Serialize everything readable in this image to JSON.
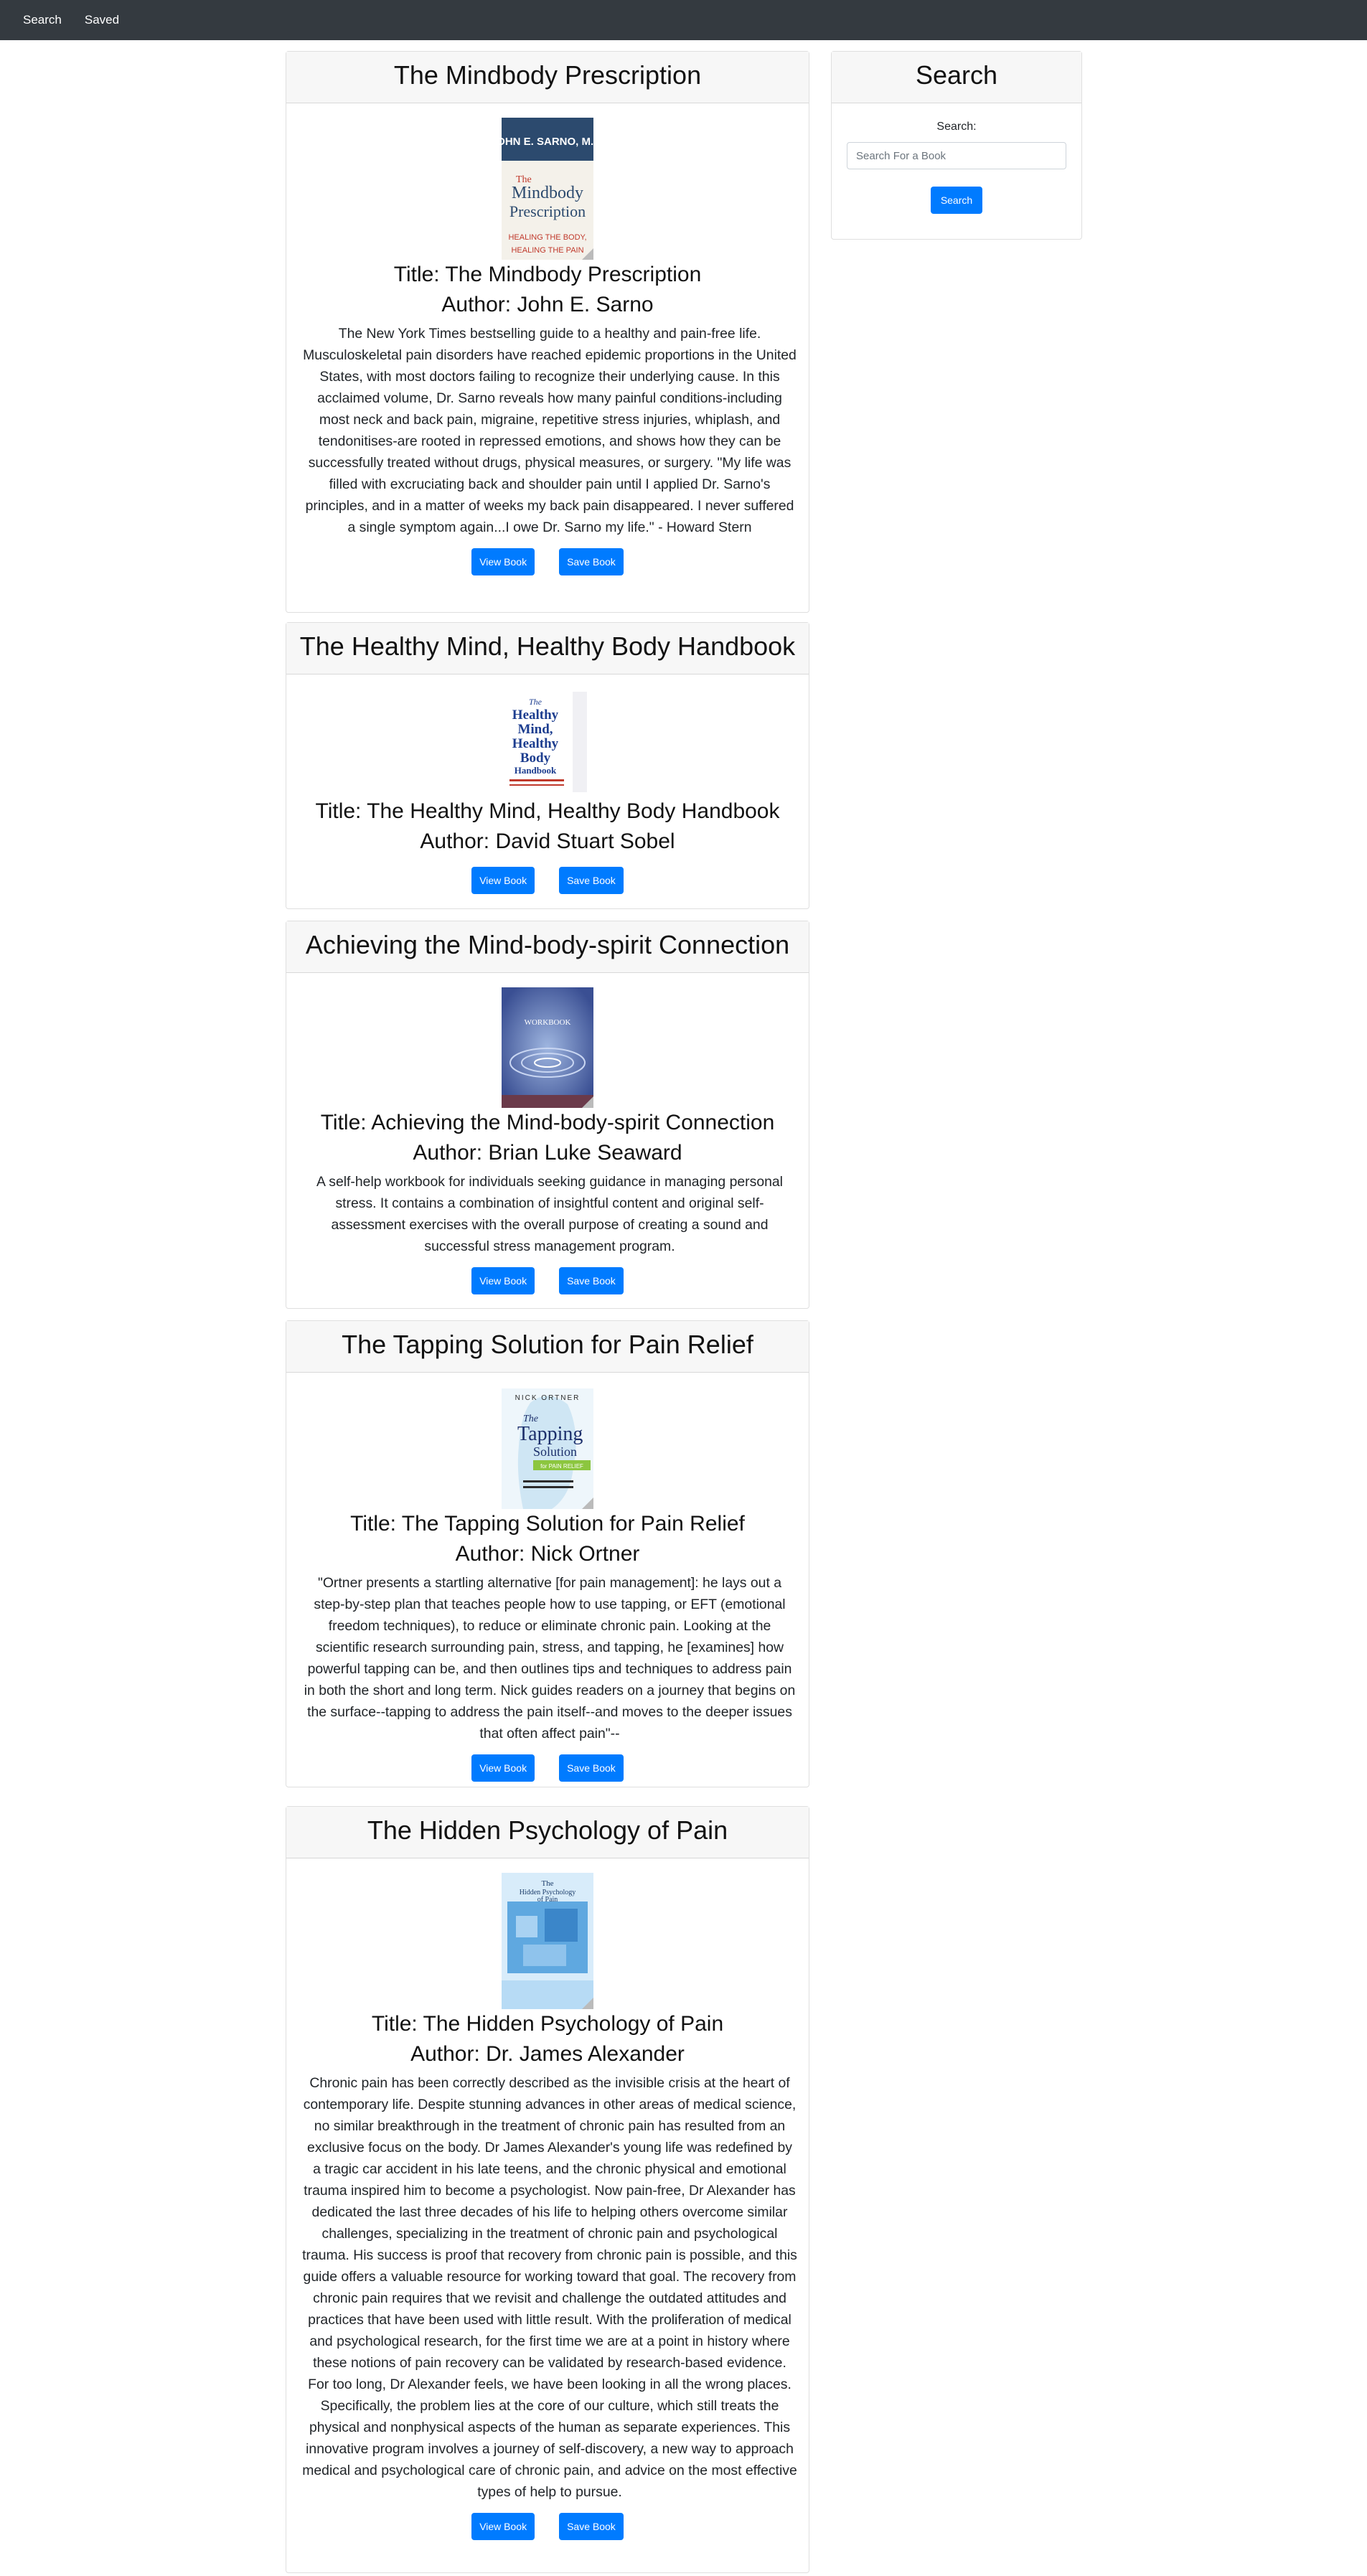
{
  "nav": {
    "links": [
      {
        "label": "Search"
      },
      {
        "label": "Saved"
      }
    ]
  },
  "search_panel": {
    "header": "Search",
    "label": "Search:",
    "placeholder": "Search For a Book",
    "button": "Search"
  },
  "colors": {
    "navbar": "#343a40",
    "primary": "#007bff",
    "card_header": "#f7f7f7"
  },
  "books": [
    {
      "heading": "The Mindbody Prescription",
      "title": "Title: The Mindbody Prescription",
      "author": "Author: John E. Sarno",
      "description": "The New York Times bestselling guide to a healthy and pain-free life. Musculoskeletal pain disorders have reached epidemic proportions in the United States, with most doctors failing to recognize their underlying cause. In this acclaimed volume, Dr. Sarno reveals how many painful conditions-including most neck and back pain, migraine, repetitive stress injuries, whiplash, and tendonitises-are rooted in repressed emotions, and shows how they can be successfully treated without drugs, physical measures, or surgery. \"My life was filled with excruciating back and shoulder pain until I applied Dr. Sarno's principles, and in a matter of weeks my back pain disappeared. I never suffered a single symptom again...I owe Dr. Sarno my life.\" - Howard Stern",
      "view_label": "View Book",
      "save_label": "Save Book",
      "cover": {
        "lines": [
          "JOHN E. SARNO, M.D.",
          "The",
          "Mindbody",
          "Prescription",
          "HEALING THE BODY,",
          "HEALING THE PAIN"
        ]
      }
    },
    {
      "heading": "The Healthy Mind, Healthy Body Handbook",
      "title": "Title: The Healthy Mind, Healthy Body Handbook",
      "author": "Author: David Stuart Sobel",
      "description": "",
      "view_label": "View Book",
      "save_label": "Save Book",
      "cover": {
        "lines": [
          "The",
          "Healthy",
          "Mind,",
          "Healthy",
          "Body",
          "Handbook"
        ]
      }
    },
    {
      "heading": "Achieving the Mind-body-spirit Connection",
      "title": "Title: Achieving the Mind-body-spirit Connection",
      "author": "Author: Brian Luke Seaward",
      "description": "A self-help workbook for individuals seeking guidance in managing personal stress. It contains a combination of insightful content and original self-assessment exercises with the overall purpose of creating a sound and successful stress management program.",
      "view_label": "View Book",
      "save_label": "Save Book",
      "cover": {
        "lines": [
          "WORKBOOK"
        ]
      }
    },
    {
      "heading": "The Tapping Solution for Pain Relief",
      "title": "Title: The Tapping Solution for Pain Relief",
      "author": "Author: Nick Ortner",
      "description": "\"Ortner presents a startling alternative [for pain management]: he lays out a step-by-step plan that teaches people how to use tapping, or EFT (emotional freedom techniques), to reduce or eliminate chronic pain. Looking at the scientific research surrounding pain, stress, and tapping, he [examines] how powerful tapping can be, and then outlines tips and techniques to address pain in both the short and long term. Nick guides readers on a journey that begins on the surface--tapping to address the pain itself--and moves to the deeper issues that often affect pain\"--",
      "view_label": "View Book",
      "save_label": "Save Book",
      "cover": {
        "lines": [
          "NICK ORTNER",
          "The",
          "Tapping",
          "Solution",
          "for PAIN RELIEF"
        ]
      }
    },
    {
      "heading": "The Hidden Psychology of Pain",
      "title": "Title: The Hidden Psychology of Pain",
      "author": "Author: Dr. James Alexander",
      "description": "Chronic pain has been correctly described as the invisible crisis at the heart of contemporary life. Despite stunning advances in other areas of medical science, no similar breakthrough in the treatment of chronic pain has resulted from an exclusive focus on the body. Dr James Alexander's young life was redefined by a tragic car accident in his late teens, and the chronic physical and emotional trauma inspired him to become a psychologist. Now pain-free, Dr Alexander has dedicated the last three decades of his life to helping others overcome similar challenges, specializing in the treatment of chronic pain and psychological trauma. His success is proof that recovery from chronic pain is possible, and this guide offers a valuable resource for working toward that goal. The recovery from chronic pain requires that we revisit and challenge the outdated attitudes and practices that have been used with little result. With the proliferation of medical and psychological research, for the first time we are at a point in history where these notions of pain recovery can be validated by research-based evidence. For too long, Dr Alexander feels, we have been looking in all the wrong places. Specifically, the problem lies at the core of our culture, which still treats the physical and nonphysical aspects of the human as separate experiences. This innovative program involves a journey of self-discovery, a new way to approach medical and psychological care of chronic pain, and advice on the most effective types of help to pursue.",
      "view_label": "View Book",
      "save_label": "Save Book",
      "cover": {
        "lines": [
          "The",
          "Hidden Psychology",
          "of Pain"
        ]
      }
    }
  ]
}
